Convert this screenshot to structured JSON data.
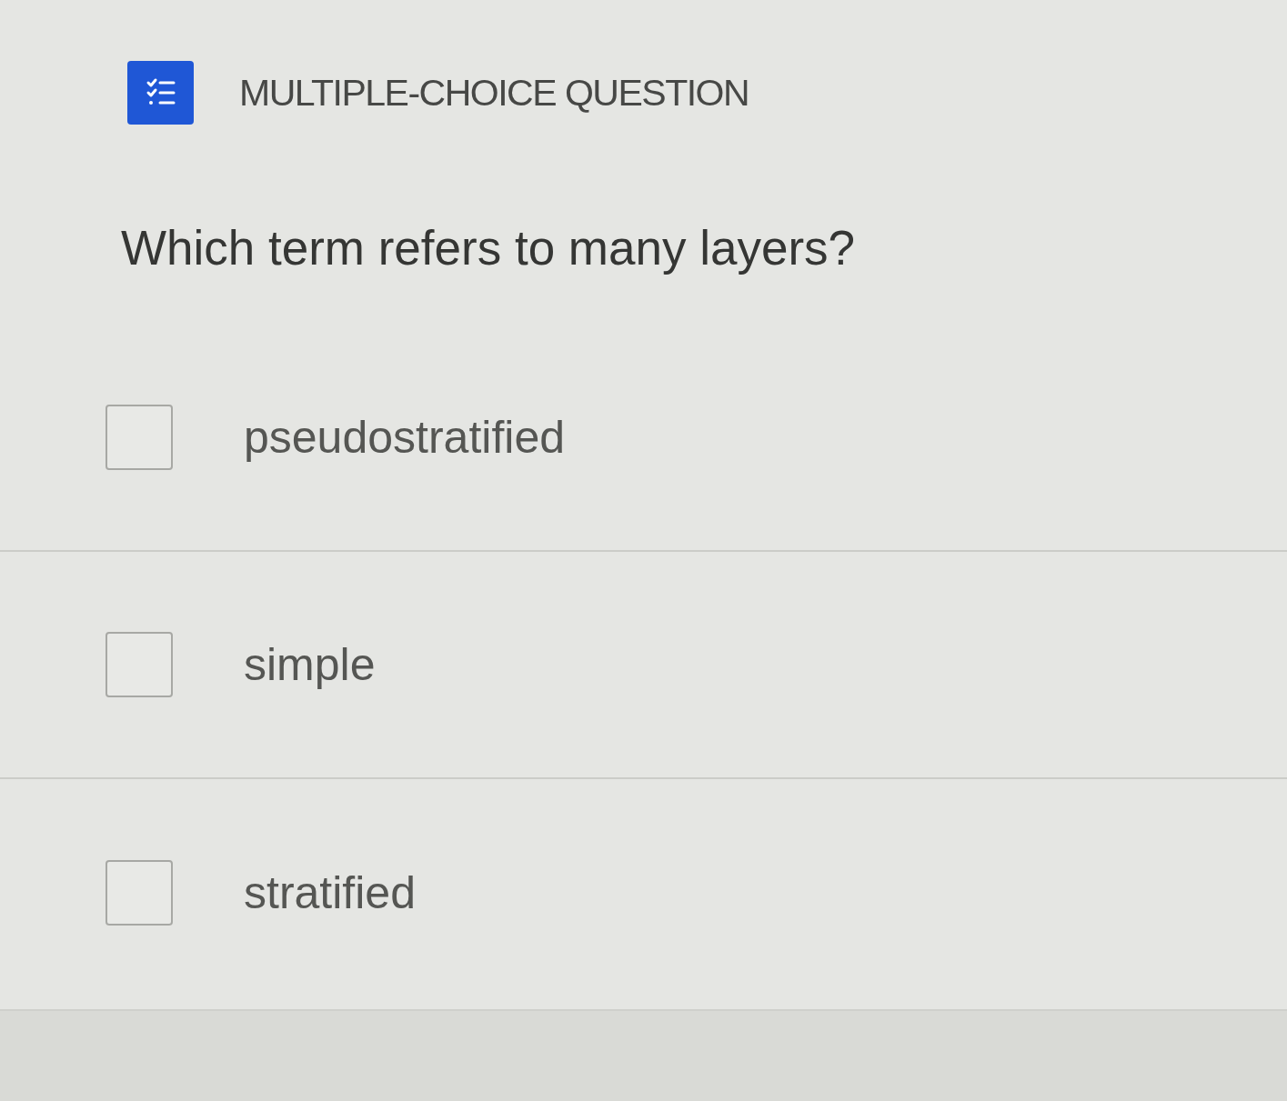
{
  "header": {
    "title": "MULTIPLE-CHOICE QUESTION"
  },
  "question": {
    "text": "Which term refers to many layers?"
  },
  "options": [
    {
      "label": "pseudostratified",
      "checked": false
    },
    {
      "label": "simple",
      "checked": false
    },
    {
      "label": "stratified",
      "checked": false
    }
  ]
}
